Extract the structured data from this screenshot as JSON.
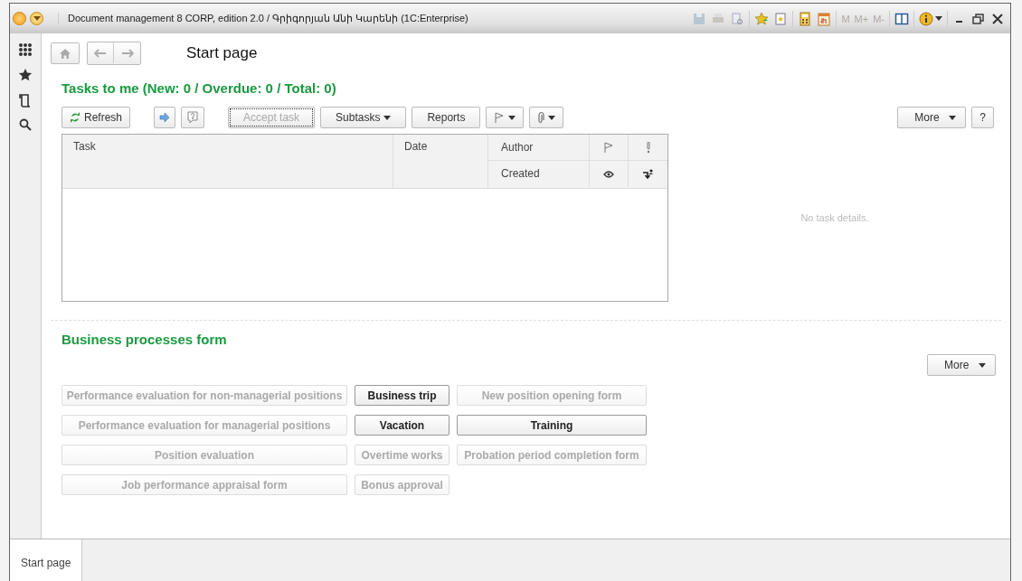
{
  "window": {
    "title": "Document management 8 CORP, edition 2.0 / Գրիգորյան Անի Կարենի  (1C:Enterprise)"
  },
  "memory_buttons": [
    {
      "label": "M",
      "disabled": true
    },
    {
      "label": "M+",
      "disabled": true
    },
    {
      "label": "M-",
      "disabled": true
    }
  ],
  "page_title": "Start page",
  "tasks": {
    "heading": "Tasks to me (New: 0 / Overdue: 0 / Total: 0)",
    "toolbar": [
      {
        "kind": "refresh",
        "label": "Refresh",
        "disabled": false
      },
      {
        "kind": "spacer"
      },
      {
        "kind": "icon-forward"
      },
      {
        "kind": "icon-help"
      },
      {
        "kind": "spacer"
      },
      {
        "kind": "plain",
        "label": "Accept task",
        "disabled": true,
        "focused": true
      },
      {
        "kind": "dropdown",
        "label": "Subtasks",
        "disabled": false
      },
      {
        "kind": "plain",
        "label": "Reports",
        "disabled": false
      },
      {
        "kind": "flag-menu"
      },
      {
        "kind": "clip-menu"
      }
    ],
    "more": "More",
    "help": "?",
    "table": {
      "columns": [
        "Task",
        "Date",
        "Author"
      ],
      "second_row": [
        "Created"
      ]
    },
    "details_placeholder": "No task details."
  },
  "business": {
    "heading": "Business processes form",
    "more": "More",
    "buttons": [
      {
        "label": "Performance evaluation for non-managerial positions",
        "disabled": true
      },
      {
        "label": "Business trip",
        "disabled": false
      },
      {
        "label": "New position opening form",
        "disabled": true
      },
      {
        "label": "Performance evaluation for managerial positions",
        "disabled": true
      },
      {
        "label": "Vacation",
        "disabled": false
      },
      {
        "label": "Training",
        "disabled": false
      },
      {
        "label": "Position evaluation",
        "disabled": true
      },
      {
        "label": "Overtime works",
        "disabled": true
      },
      {
        "label": "Probation period completion form",
        "disabled": true
      },
      {
        "label": "Job performance appraisal form",
        "disabled": true
      },
      {
        "label": "Bonus approval",
        "disabled": true
      }
    ]
  },
  "open_tabs": [
    {
      "label": "Start page",
      "selected": true
    }
  ]
}
